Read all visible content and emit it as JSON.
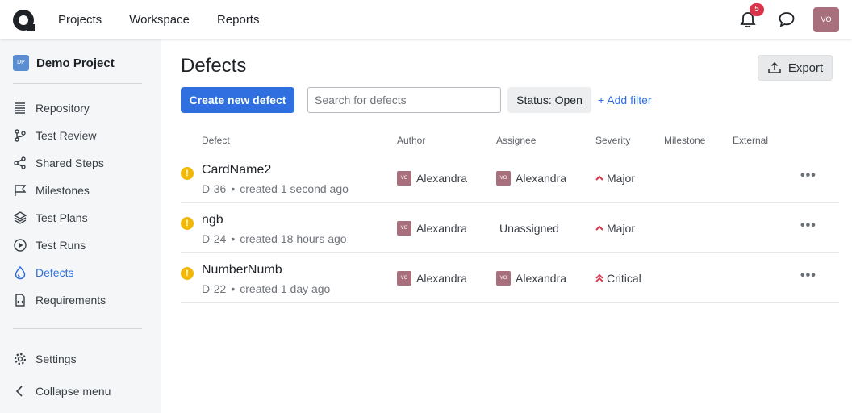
{
  "nav": {
    "items": [
      "Projects",
      "Workspace",
      "Reports"
    ],
    "notifications": "5",
    "user_initials": "VO"
  },
  "sidebar": {
    "project_initials": "DP",
    "project_name": "Demo Project",
    "items": [
      {
        "label": "Repository",
        "icon": "repository-icon"
      },
      {
        "label": "Test Review",
        "icon": "test-review-icon"
      },
      {
        "label": "Shared Steps",
        "icon": "shared-steps-icon"
      },
      {
        "label": "Milestones",
        "icon": "milestones-icon"
      },
      {
        "label": "Test Plans",
        "icon": "test-plans-icon"
      },
      {
        "label": "Test Runs",
        "icon": "test-runs-icon"
      },
      {
        "label": "Defects",
        "icon": "defects-icon",
        "active": true
      },
      {
        "label": "Requirements",
        "icon": "requirements-icon"
      }
    ],
    "settings": "Settings",
    "collapse": "Collapse menu"
  },
  "page": {
    "title": "Defects",
    "export": "Export",
    "create": "Create new defect",
    "search_placeholder": "Search for defects",
    "status_filter": "Status: Open",
    "add_filter": "+ Add filter"
  },
  "table": {
    "headers": [
      "Defect",
      "Author",
      "Assignee",
      "Severity",
      "Milestone",
      "External"
    ],
    "rows": [
      {
        "name": "CardName2",
        "id": "D-36",
        "created": "created 1 second ago",
        "author": "Alexandra",
        "author_initials": "VO",
        "assignee": "Alexandra",
        "assignee_initials": "VO",
        "severity": "Major"
      },
      {
        "name": "ngb",
        "id": "D-24",
        "created": "created 18 hours ago",
        "author": "Alexandra",
        "author_initials": "VO",
        "assignee": "Unassigned",
        "assignee_initials": "",
        "severity": "Major"
      },
      {
        "name": "NumberNumb",
        "id": "D-22",
        "created": "created 1 day ago",
        "author": "Alexandra",
        "author_initials": "VO",
        "assignee": "Alexandra",
        "assignee_initials": "VO",
        "severity": "Critical"
      }
    ]
  },
  "colors": {
    "accent": "#2f6fe0",
    "warning": "#f2b807",
    "severity": "#d9344a",
    "avatar": "#a8707c"
  }
}
